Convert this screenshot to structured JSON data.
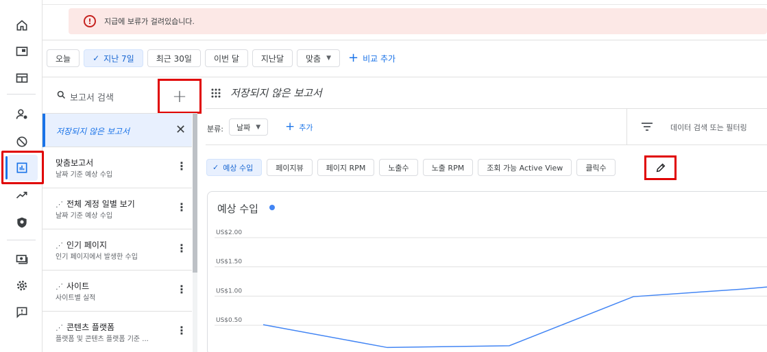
{
  "alert": {
    "icon": "error-circle-icon",
    "text": "지급에 보류가 걸려있습니다."
  },
  "rail": {
    "items": [
      "home-icon",
      "ad-unit-icon",
      "sites-icon",
      "privacy-messaging-icon",
      "block-icon",
      "reports-icon",
      "optimization-icon",
      "policy-icon",
      "payments-icon",
      "settings-icon",
      "feedback-icon"
    ],
    "active": "reports-icon"
  },
  "date_chips": [
    {
      "label": "오늘",
      "selected": false
    },
    {
      "label": "지난 7일",
      "selected": true
    },
    {
      "label": "최근 30일",
      "selected": false
    },
    {
      "label": "이번 달",
      "selected": false
    },
    {
      "label": "지난달",
      "selected": false
    },
    {
      "label": "맞춤",
      "selected": false,
      "dropdown": true
    }
  ],
  "add_compare": "비교 추가",
  "search": {
    "placeholder": "보고서 검색"
  },
  "new_report_button": "+",
  "reports": [
    {
      "title": "저장되지 않은 보고서",
      "subtitle": "",
      "unsaved": true
    },
    {
      "title": "맞춤보고서",
      "subtitle": "날짜 기준 예상 수입",
      "spark": false
    },
    {
      "title": "전체 계정 일별 보기",
      "subtitle": "날짜 기준 예상 수입",
      "spark": true
    },
    {
      "title": "인기 페이지",
      "subtitle": "인기 페이지에서 발생한 수입",
      "spark": true
    },
    {
      "title": "사이트",
      "subtitle": "사이트별 실적",
      "spark": true
    },
    {
      "title": "콘텐츠 플랫폼",
      "subtitle": "플랫폼 및 콘텐츠 플랫폼 기준 ...",
      "spark": true
    }
  ],
  "report_title": "저장되지 않은 보고서",
  "breakdown": {
    "label": "분류:",
    "value": "날짜",
    "add_label": "추가"
  },
  "filter_text": "데이터 검색 또는 필터링",
  "metrics": [
    {
      "label": "예상 수입",
      "selected": true
    },
    {
      "label": "페이지뷰",
      "selected": false
    },
    {
      "label": "페이지 RPM",
      "selected": false
    },
    {
      "label": "노출수",
      "selected": false
    },
    {
      "label": "노출 RPM",
      "selected": false
    },
    {
      "label": "조회 가능 Active View",
      "selected": false
    },
    {
      "label": "클릭수",
      "selected": false
    }
  ],
  "card_title": "예상 수입",
  "colors": {
    "accent": "#1a73e8",
    "series": "#4285f4",
    "alert_bg": "#fce8e6",
    "highlight": "#e00000"
  },
  "chart_data": {
    "type": "line",
    "yticks": [
      "US$2.00",
      "US$1.50",
      "US$1.00",
      "US$0.50"
    ],
    "ylim": [
      0.5,
      2.0
    ],
    "series": [
      {
        "values": [
          0.51,
          0.12,
          0.15,
          0.99,
          1.12,
          1.17
        ]
      }
    ]
  }
}
